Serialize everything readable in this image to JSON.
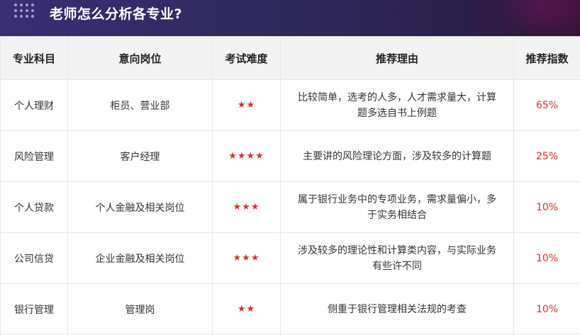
{
  "header": {
    "title": "老师怎么分析各专业?"
  },
  "table": {
    "headers": [
      "专业科目",
      "意向岗位",
      "考试难度",
      "推荐理由",
      "推荐指数"
    ],
    "rows": [
      {
        "subject": "个人理财",
        "position": "柜员、营业部",
        "difficulty": "★★",
        "reason": "比较简单，选考的人多，人才需求量大，计算题多选自书上例题",
        "index": "65%"
      },
      {
        "subject": "风险管理",
        "position": "客户经理",
        "difficulty": "★★★★",
        "reason": "主要讲的风险理论方面，涉及较多的计算题",
        "index": "25%"
      },
      {
        "subject": "个人贷款",
        "position": "个人金融及相关岗位",
        "difficulty": "★★★",
        "reason": "属于银行业务中的专项业务，需求量偏小，多于实务相结合",
        "index": "10%"
      },
      {
        "subject": "公司信贷",
        "position": "企业金融及相关岗位",
        "difficulty": "★★★",
        "reason": "涉及较多的理论性和计算类内容，与实际业务有些许不同",
        "index": "10%"
      },
      {
        "subject": "银行管理",
        "position": "管理岗",
        "difficulty": "★★",
        "reason": "侧重于银行管理相关法规的考查",
        "index": "10%"
      }
    ]
  },
  "colors": {
    "header_bg": "#33296a",
    "accent": "#d9312b",
    "table_header_bg": "#f3f3f3"
  }
}
